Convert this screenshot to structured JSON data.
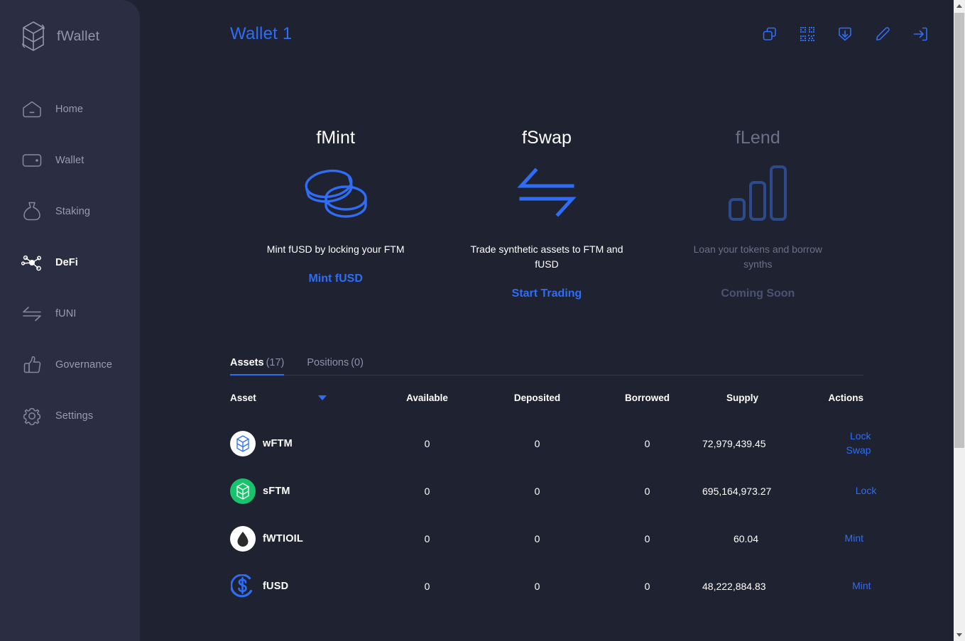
{
  "brand": {
    "name": "fWallet",
    "logo_icon": "fantom-logo-icon"
  },
  "sidebar": {
    "items": [
      {
        "label": "Home",
        "icon": "home-icon",
        "active": false
      },
      {
        "label": "Wallet",
        "icon": "wallet-icon",
        "active": false
      },
      {
        "label": "Staking",
        "icon": "staking-bag-icon",
        "active": false
      },
      {
        "label": "DeFi",
        "icon": "defi-nodes-icon",
        "active": true
      },
      {
        "label": "fUNI",
        "icon": "swap-arrows-icon",
        "active": false
      },
      {
        "label": "Governance",
        "icon": "thumbs-up-icon",
        "active": false
      },
      {
        "label": "Settings",
        "icon": "gear-icon",
        "active": false
      }
    ]
  },
  "topbar": {
    "wallet_title": "Wallet 1",
    "actions": [
      {
        "name": "copy-address-icon"
      },
      {
        "name": "qr-code-icon"
      },
      {
        "name": "receive-download-icon"
      },
      {
        "name": "edit-pencil-icon"
      },
      {
        "name": "logout-icon"
      }
    ]
  },
  "cards": [
    {
      "title": "fMint",
      "art_icon": "coins-stack-icon",
      "description": "Mint fUSD by locking your FTM",
      "link_label": "Mint fUSD",
      "disabled": false
    },
    {
      "title": "fSwap",
      "art_icon": "swap-arrows-icon",
      "description": "Trade synthetic assets to FTM and fUSD",
      "link_label": "Start Trading",
      "disabled": false
    },
    {
      "title": "fLend",
      "art_icon": "bar-chart-icon",
      "description": "Loan your tokens and borrow synths",
      "link_label": "Coming Soon",
      "disabled": true
    }
  ],
  "tabs": [
    {
      "name": "Assets",
      "count": "(17)",
      "active": true
    },
    {
      "name": "Positions",
      "count": "(0)",
      "active": false
    }
  ],
  "table": {
    "headers": {
      "asset": "Asset",
      "available": "Available",
      "deposited": "Deposited",
      "borrowed": "Borrowed",
      "supply": "Supply",
      "actions": "Actions"
    },
    "rows": [
      {
        "asset": "wFTM",
        "icon": "wftm-token-icon",
        "available": "0",
        "deposited": "0",
        "borrowed": "0",
        "supply": "72,979,439.45",
        "actions": [
          "Lock",
          "Swap"
        ]
      },
      {
        "asset": "sFTM",
        "icon": "sftm-token-icon",
        "available": "0",
        "deposited": "0",
        "borrowed": "0",
        "supply": "695,164,973.27",
        "actions": [
          "Lock"
        ]
      },
      {
        "asset": "fWTIOIL",
        "icon": "fwtioil-token-icon",
        "available": "0",
        "deposited": "0",
        "borrowed": "0",
        "supply": "60.04",
        "actions": [
          "Mint"
        ]
      },
      {
        "asset": "fUSD",
        "icon": "fusd-token-icon",
        "available": "0",
        "deposited": "0",
        "borrowed": "0",
        "supply": "48,222,884.83",
        "actions": [
          "Mint"
        ]
      }
    ]
  },
  "colors": {
    "accent_blue": "#2f6df6",
    "background": "#1f2230",
    "sidebar_background": "#2b2e42",
    "text_primary": "#ffffff",
    "text_muted": "#8b92a9",
    "disabled": "#6a7189",
    "green_token": "#18c46b"
  }
}
